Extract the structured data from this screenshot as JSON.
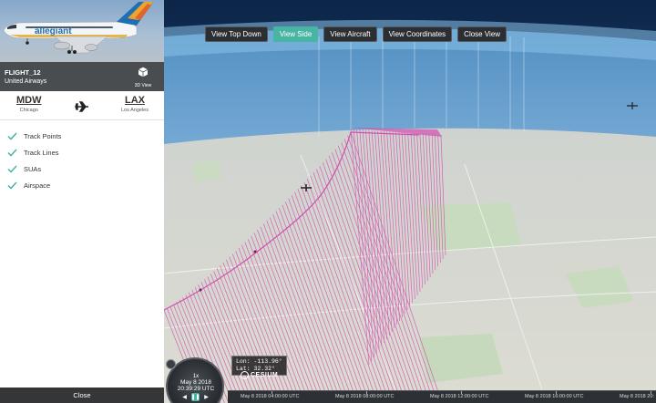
{
  "flight": {
    "id": "FLIGHT_12",
    "airline": "United Airways",
    "view_3d_label": "3D View",
    "livery_text": "allegiant"
  },
  "route": {
    "origin": {
      "code": "MDW",
      "city": "Chicago"
    },
    "destination": {
      "code": "LAX",
      "city": "Los Angeles"
    }
  },
  "layers": [
    {
      "label": "Track Points",
      "checked": true
    },
    {
      "label": "Track Lines",
      "checked": true
    },
    {
      "label": "SUAs",
      "checked": true
    },
    {
      "label": "Airspace",
      "checked": true
    }
  ],
  "sidebar_close_label": "Close",
  "view_buttons": [
    {
      "label": "View Top Down",
      "active": false
    },
    {
      "label": "View Side",
      "active": true
    },
    {
      "label": "View Aircraft",
      "active": false
    },
    {
      "label": "View Coordinates",
      "active": false
    },
    {
      "label": "Close View",
      "active": false
    }
  ],
  "coordinates": {
    "lon": "Lon: -113.96°",
    "lat": "Lat:   32.32°"
  },
  "animation": {
    "speed": "1x",
    "date": "May 8 2018",
    "time": "20:39:29 UTC"
  },
  "cesium_label": "CESIUM",
  "timeline_labels": [
    "May 8 2018 04:00:00 UTC",
    "May 8 2018 08:00:00 UTC",
    "May 8 2018 12:00:00 UTC",
    "May 8 2018 16:00:00 UTC",
    "May 8 2018 20:"
  ],
  "colors": {
    "accent": "#48b4a3",
    "track": "#d24fb0",
    "sidebar_header": "#4a4d50"
  }
}
